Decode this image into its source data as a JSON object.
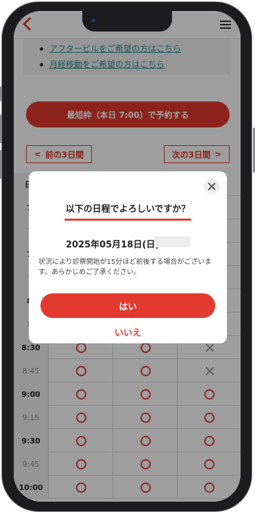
{
  "header": {
    "back_icon": "chevron-left-icon",
    "menu_icon": "hamburger-menu-icon"
  },
  "info_links": [
    "アフターピルをご希望の方はこちら",
    "月経移動をご希望の方はこちら"
  ],
  "reserve_button": "最短枠（本日 7:00）で予約する",
  "nav": {
    "prev": "前の3日間",
    "next": "次の3日間"
  },
  "table": {
    "first_header_fragment": "日",
    "rows": [
      {
        "time": "7:",
        "bold": true,
        "marks": [
          "",
          "",
          ""
        ]
      },
      {
        "time": "7:",
        "bold": false,
        "marks": [
          "",
          "",
          ""
        ]
      },
      {
        "time": "7:",
        "bold": true,
        "marks": [
          "",
          "",
          ""
        ]
      },
      {
        "time": "7:",
        "bold": false,
        "marks": [
          "",
          "",
          ""
        ]
      },
      {
        "time": "8:",
        "bold": true,
        "marks": [
          "",
          "",
          ""
        ]
      },
      {
        "time": "8:",
        "bold": false,
        "marks": [
          "",
          "",
          ""
        ]
      },
      {
        "time": "8:30",
        "bold": true,
        "marks": [
          "circle",
          "circle",
          "cross"
        ]
      },
      {
        "time": "8:45",
        "bold": false,
        "marks": [
          "circle",
          "circle",
          "cross"
        ]
      },
      {
        "time": "9:00",
        "bold": true,
        "marks": [
          "circle",
          "circle",
          "circle"
        ]
      },
      {
        "time": "9:15",
        "bold": false,
        "marks": [
          "circle",
          "circle",
          "circle"
        ]
      },
      {
        "time": "9:30",
        "bold": true,
        "marks": [
          "circle",
          "circle",
          "circle"
        ]
      },
      {
        "time": "9:45",
        "bold": false,
        "marks": [
          "circle",
          "circle",
          "circle"
        ]
      },
      {
        "time": "10:00",
        "bold": true,
        "marks": [
          "circle",
          "circle",
          "circle"
        ]
      }
    ]
  },
  "modal": {
    "title": "以下の日程でよろしいですか？",
    "date": "2025年05月18日(日)",
    "note": "状況により診察開始が15分ほど前後する場合がございます。あらかじめご了承ください。",
    "yes": "はい",
    "no": "いいえ",
    "close_icon": "close-icon"
  },
  "colors": {
    "accent": "#e33a2f",
    "link": "#2a8b8f"
  }
}
